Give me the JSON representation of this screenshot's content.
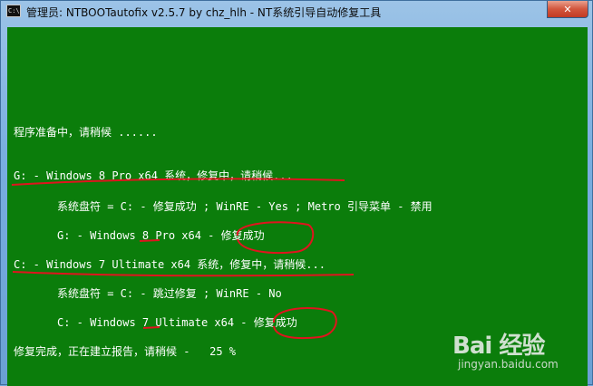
{
  "window": {
    "title": "管理员:  NTBOOTautofix v2.5.7 by chz_hlh - NT系统引导自动修复工具",
    "icon_text": "C:\\",
    "close_symbol": "✕"
  },
  "console": {
    "background": "#0b7d0b",
    "text_color": "#ffffff",
    "lines": [
      "程序准备中，请稍候 ......",
      "G: - Windows 8 Pro x64 系统，修复中，请稍候...",
      "系统盘符 = C: - 修复成功 ; WinRE - Yes ; Metro 引导菜单 - 禁用",
      "G: - Windows 8 Pro x64 - 修复成功",
      "C: - Windows 7 Ultimate x64 系统，修复中，请稍候...",
      "系统盘符 = C: - 跳过修复 ; WinRE - No",
      "C: - Windows 7 Ultimate x64 - 修复成功",
      "修复完成，正在建立报告，请稍候 -   25 %"
    ]
  },
  "annotation_color": "#e0141e",
  "watermark": {
    "brand": "Bai 经验",
    "url": "jingyan.baidu.com"
  }
}
